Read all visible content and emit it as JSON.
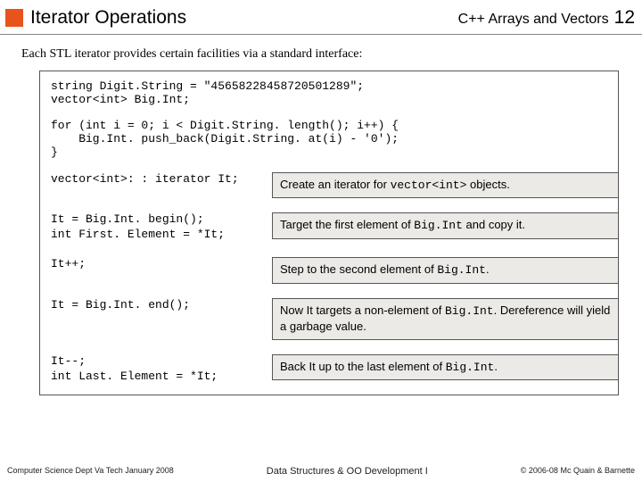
{
  "header": {
    "title": "Iterator Operations",
    "subtitle": "C++ Arrays and Vectors",
    "page": "12"
  },
  "intro": "Each STL iterator provides certain facilities via a standard interface:",
  "code": {
    "decl": "string Digit.String = \"45658228458720501289\";\nvector<int> Big.Int;",
    "loop": "for (int i = 0; i < Digit.String. length(); i++) {\n    Big.Int. push_back(Digit.String. at(i) - '0');\n}"
  },
  "rows": [
    {
      "code": "vector<int>: : iterator It;",
      "desc_pre": "Create an iterator for ",
      "desc_mono": "vector<int>",
      "desc_post": " objects."
    },
    {
      "code": "It = Big.Int. begin();\nint First. Element = *It;",
      "desc_pre": "Target the first element of ",
      "desc_mono": "Big.Int",
      "desc_post": " and copy it."
    },
    {
      "code": "It++;",
      "desc_pre": "Step to the second element of ",
      "desc_mono": "Big.Int",
      "desc_post": "."
    },
    {
      "code": "It = Big.Int. end();",
      "desc_pre": "Now It targets a non-element of ",
      "desc_mono": "Big.Int",
      "desc_post": ". Dereference will yield a garbage value."
    },
    {
      "code": "It--;\nint Last. Element = *It;",
      "desc_pre": "Back It up to the last element of ",
      "desc_mono": "Big.Int",
      "desc_post": "."
    }
  ],
  "footer": {
    "left": "Computer Science Dept Va Tech January 2008",
    "center": "Data Structures & OO Development I",
    "right": "© 2006-08 Mc Quain & Barnette"
  }
}
